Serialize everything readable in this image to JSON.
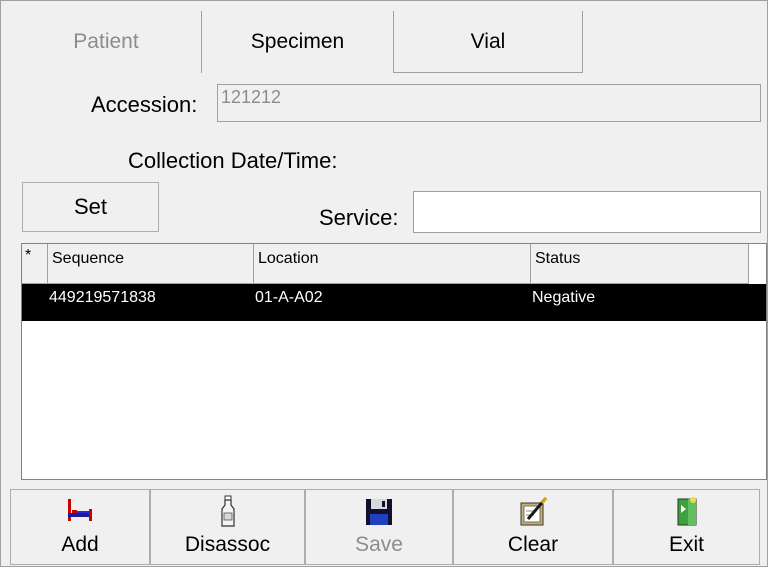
{
  "tabs": [
    {
      "label": "Patient",
      "enabled": false
    },
    {
      "label": "Specimen",
      "enabled": true
    },
    {
      "label": "Vial",
      "enabled": true
    }
  ],
  "accession": {
    "label": "Accession:",
    "value": "121212"
  },
  "collection": {
    "label": "Collection Date/Time:"
  },
  "set_button": {
    "label": "Set"
  },
  "service": {
    "label": "Service:",
    "value": ""
  },
  "grid": {
    "columns": [
      "*",
      "Sequence",
      "Location",
      "Status"
    ],
    "rows": [
      {
        "marker": "",
        "sequence": "449219571838",
        "location": "01-A-A02",
        "status": "Negative"
      }
    ]
  },
  "toolbar": {
    "add": {
      "label": "Add",
      "icon": "bed-icon"
    },
    "disassoc": {
      "label": "Disassoc",
      "icon": "bottle-icon"
    },
    "save": {
      "label": "Save",
      "icon": "floppy-disk-icon",
      "enabled": false
    },
    "clear": {
      "label": "Clear",
      "icon": "clipboard-pen-icon"
    },
    "exit": {
      "label": "Exit",
      "icon": "door-icon"
    }
  },
  "colors": {
    "selection": "#000000",
    "background": "#f0f0f0",
    "disabled_text": "#8c8c8c"
  }
}
